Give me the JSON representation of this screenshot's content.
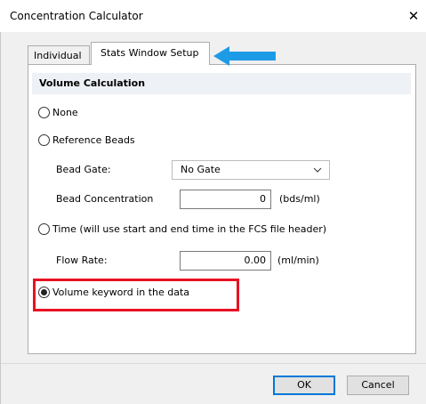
{
  "window": {
    "title": "Concentration Calculator",
    "close_glyph": "✕"
  },
  "tabs": [
    {
      "label": "Individual",
      "selected": false
    },
    {
      "label": "Stats Window Setup",
      "selected": true
    }
  ],
  "section": {
    "title": "Volume Calculation"
  },
  "options": {
    "none": {
      "label": "None",
      "selected": false
    },
    "reference_beads": {
      "label": "Reference Beads",
      "selected": false
    },
    "time": {
      "label": "Time (will use start and end time in the FCS file header)",
      "selected": false
    },
    "volume_keyword": {
      "label": "Volume keyword in the data",
      "selected": true
    }
  },
  "bead_gate": {
    "label": "Bead Gate:",
    "value": "No Gate"
  },
  "bead_concentration": {
    "label": "Bead Concentration",
    "value": "0",
    "unit": "(bds/ml)"
  },
  "flow_rate": {
    "label": "Flow Rate:",
    "value": "0.00",
    "unit": "(ml/min)"
  },
  "buttons": {
    "ok": "OK",
    "cancel": "Cancel"
  },
  "colors": {
    "arrow": "#1e9be6",
    "highlight": "#e81123",
    "ok_border": "#0078d7"
  },
  "icons": {
    "arrow": "left-arrow-icon",
    "dropdown": "chevron-down-icon",
    "close": "close-icon"
  }
}
